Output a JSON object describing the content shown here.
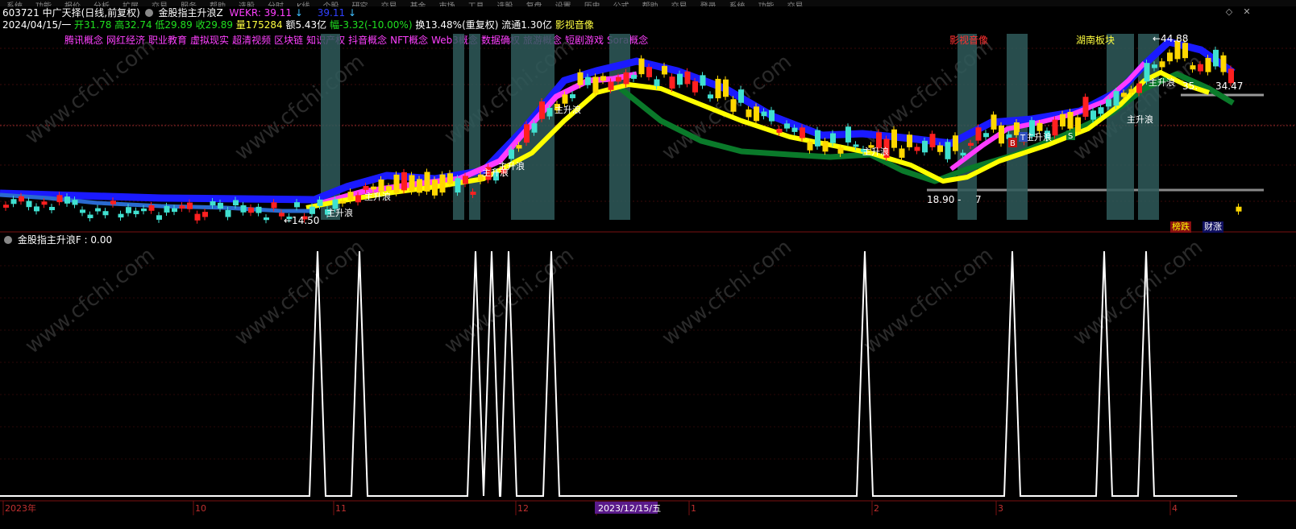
{
  "menu": [
    "系统",
    "功能",
    "报价",
    "分析",
    "扩展",
    "交易",
    "服务",
    "帮助",
    "选股",
    "分时",
    "K线",
    "个股",
    "研究",
    "交易",
    "基金",
    "市场",
    "工具",
    "选股",
    "复盘",
    "设置",
    "历史",
    "公式",
    "帮助",
    "交易",
    "登录",
    "系统",
    "功能",
    "交易"
  ],
  "header": {
    "code_name": "603721 中广天择(日线,前复权)",
    "formula_name": "金股指主升浪Z",
    "wekr_label": "WEKR: 39.11",
    "wekr_arrow": "↓",
    "wekr2_label": "39.11",
    "wekr2_arrow": "↓"
  },
  "quote": {
    "date": "2024/04/15/一",
    "open": "开31.78",
    "high": "高32.74",
    "low": "低29.89",
    "close": "收29.89",
    "volume": "量175284",
    "amount": "额5.43亿",
    "change": "幅-3.32(-10.00%)",
    "turnover": "换13.48%(重复权)",
    "float_val": "流通1.30亿",
    "sector": "影视音像"
  },
  "concepts": [
    "腾讯概念",
    "网红经济",
    "职业教育",
    "虚拟现实",
    "超清视频",
    "区块链",
    "知识产权",
    "抖音概念",
    "NFT概念",
    "Web3概念",
    "数据确权",
    "旅游概念",
    "短剧游戏",
    "Sora概念"
  ],
  "chart_labels": {
    "sector_tag_1": "影视音像",
    "sector_tag_2": "湖南板块",
    "price_high": "←44.88",
    "price_mid": "35.",
    "price_mid2": "34.47",
    "price_low1": "←14.50",
    "price_low2": "18.90 -",
    "price_low2b": "7",
    "wave_labels": [
      "主升浪",
      "主升浪",
      "主升浪",
      "主升浪",
      "主升浪",
      "主升浪",
      "主升浪",
      "主升浪",
      "主升浪"
    ],
    "marker_B": "B",
    "marker_T": "T",
    "marker_S": "S",
    "badge_down": "榜跌",
    "badge_up": "财涨"
  },
  "indicator": {
    "title": "金股指主升浪F : 0.00"
  },
  "xaxis": {
    "labels": [
      "2023年",
      "10",
      "11",
      "12",
      "2023/12/15/五",
      "1",
      "2",
      "3",
      "4"
    ]
  },
  "watermark": "www.cfchi.com",
  "colors": {
    "bg": "#000000",
    "blue_ma": "#1a1aff",
    "magenta_ma": "#ff3cff",
    "yellow_ma": "#ffff00",
    "green_band": "#0a7a2a",
    "up_candle": "#ff2020",
    "down_candle": "#40e0d0",
    "highlight": "#2f5a5a",
    "signal": "#ffffff"
  },
  "chart_data": [
    {
      "type": "candlestick",
      "title": "603721 中广天择(日线,前复权)",
      "series": [
        {
          "name": "WEKR",
          "values": [
            39.11
          ]
        }
      ],
      "annotated_prices": {
        "high": 44.88,
        "low_oct": 14.5,
        "low_feb": 18.9,
        "recent": 34.47
      },
      "x_range": [
        "2023年",
        "4"
      ],
      "grid": true
    },
    {
      "type": "line",
      "title": "金股指主升浪F",
      "current_value": 0.0,
      "signal_peaks_count": 10,
      "ylim": [
        0,
        1
      ]
    }
  ]
}
